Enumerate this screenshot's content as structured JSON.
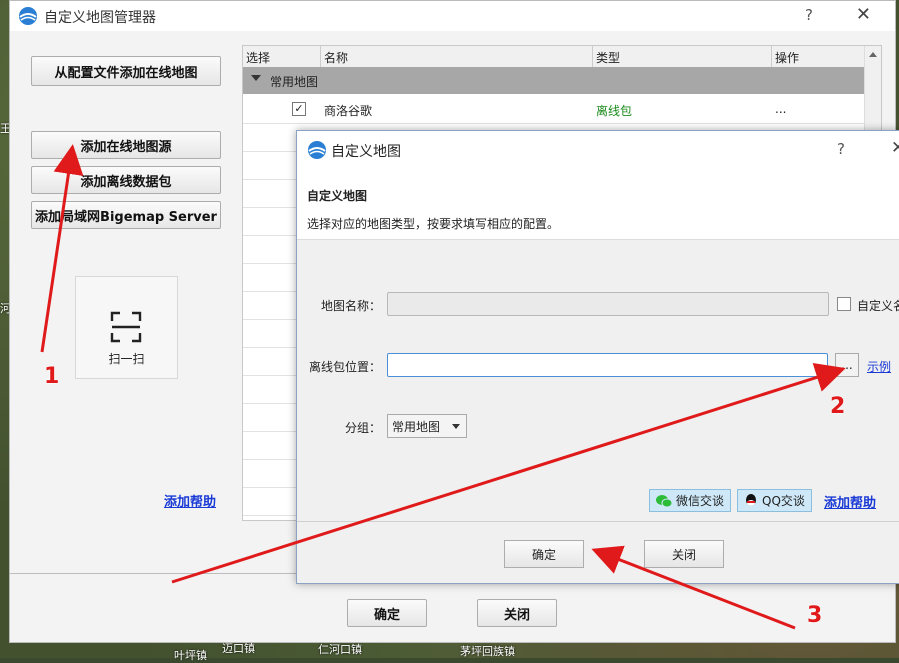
{
  "background": {
    "map_labels": [
      "迈口镇",
      "仁河口镇",
      "茅坪回族镇",
      "叶坪镇",
      "王",
      "河"
    ]
  },
  "window": {
    "title": "自定义地图管理器",
    "help": "?",
    "close": "✕"
  },
  "left_panel": {
    "add_from_config": "从配置文件添加在线地图",
    "add_online_source": "添加在线地图源",
    "add_offline_pack": "添加离线数据包",
    "add_lan_server": "添加局域网Bigemap Server",
    "scan": "扫一扫",
    "help_link": "添加帮助"
  },
  "table": {
    "headers": [
      "选择",
      "名称",
      "类型",
      "操作"
    ],
    "group": "常用地图",
    "first_row": {
      "checked": "✓",
      "name": "商洛谷歌",
      "type": "离线包",
      "action": "..."
    },
    "type_color": "#1a8a1a"
  },
  "footer": {
    "ok": "确定",
    "close": "关闭"
  },
  "dialog": {
    "title": "自定义地图",
    "help": "?",
    "close": "✕",
    "heading": "自定义地图",
    "subheading": "选择对应的地图类型，按要求填写相应的配置。",
    "map_name_label": "地图名称：",
    "custom_name_label": "自定义名",
    "offline_location_label": "离线包位置：",
    "browse": "...",
    "example_link": "示例",
    "group_label": "分组：",
    "group_value": "常用地图",
    "wechat": "微信交谈",
    "qq": "QQ交谈",
    "help_link": "添加帮助",
    "ok": "确定",
    "close_btn": "关闭"
  },
  "annotations": {
    "a1": "1",
    "a2": "2",
    "a3": "3",
    "color": "#e01a1a"
  }
}
